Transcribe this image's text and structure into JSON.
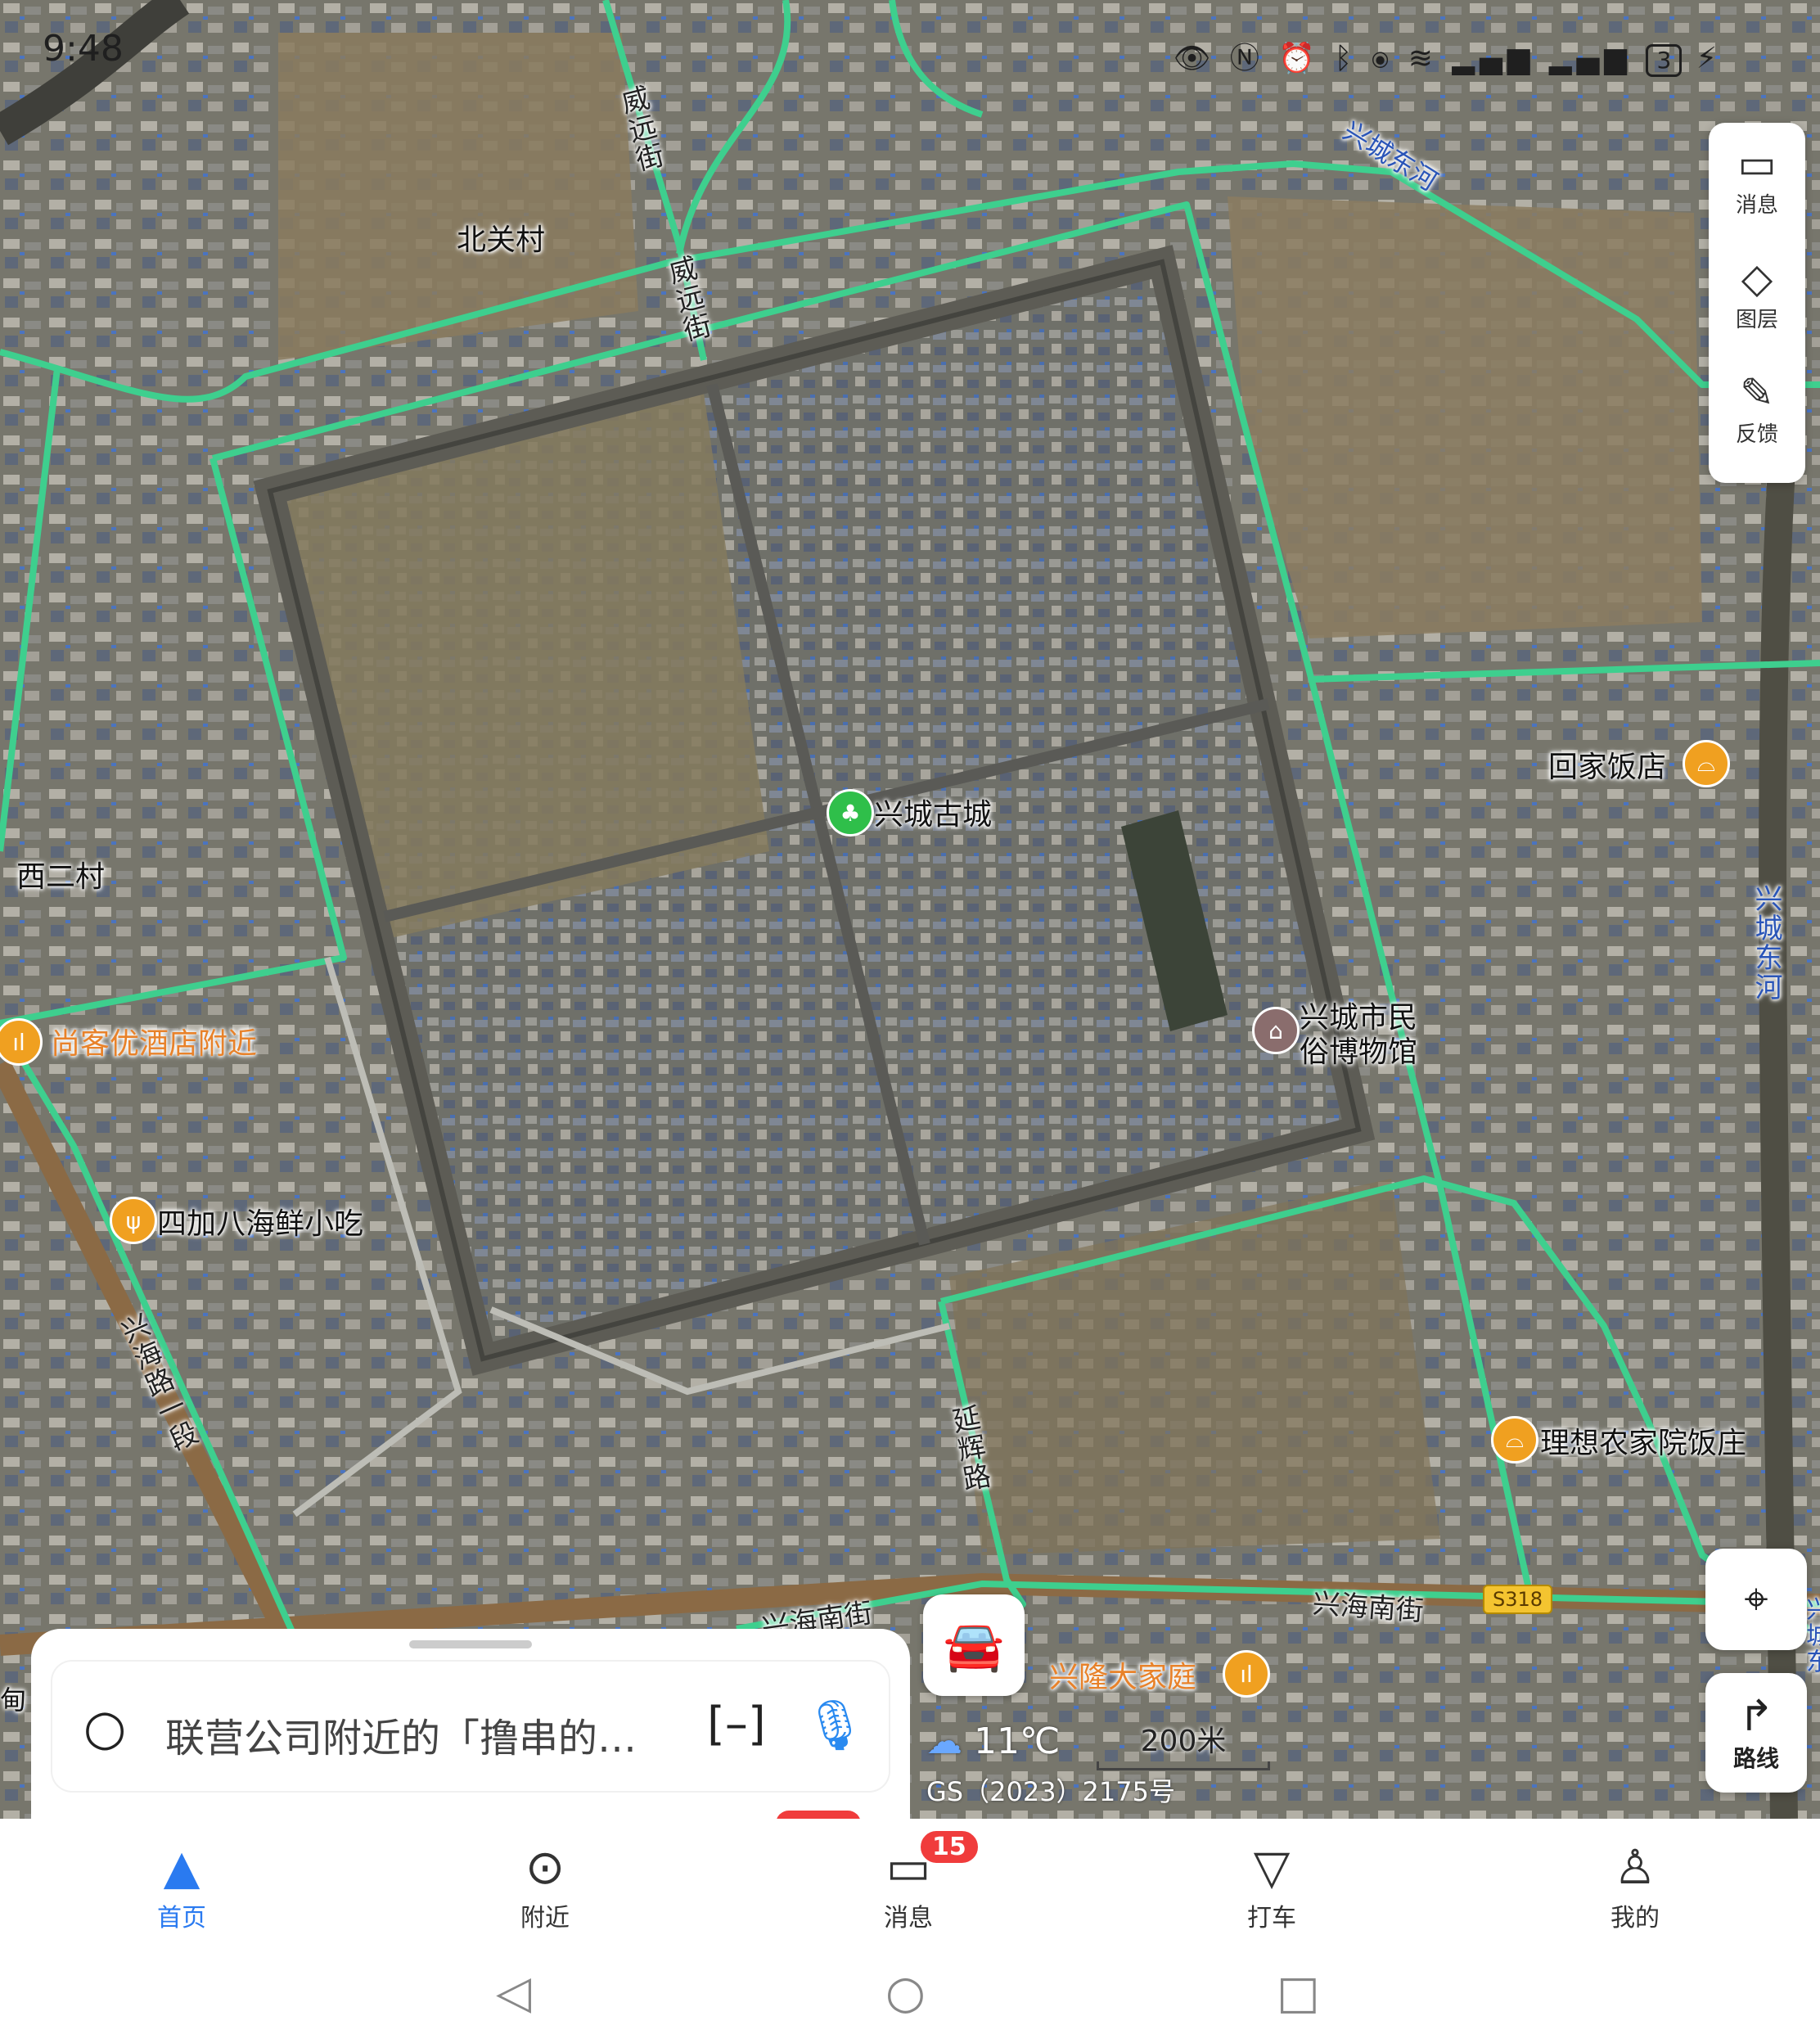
{
  "status_bar": {
    "time": "9:48",
    "icons": [
      "eye-icon",
      "nfc-icon",
      "alarm-icon",
      "bluetooth-icon",
      "location-icon",
      "wifi-icon",
      "signal-icon",
      "signal-icon"
    ],
    "battery": "3"
  },
  "map": {
    "type": "satellite",
    "road_color": "#3ecf8e",
    "labels": {
      "beiguan": "北关村",
      "weiyuan1": "威远街",
      "weiyuan2": "威远街",
      "xicheng_river_top": "兴城东河",
      "xicheng_river_right": "兴城东河",
      "xi_er_cun": "西二村",
      "xinghai_road": "兴海路一段",
      "xinghai_south1": "兴海南街",
      "xinghai_south2": "兴海南街",
      "yanhui": "延辉路",
      "xingcheng_partial": "兴城东"
    },
    "pois": {
      "gucheng": "兴城古城",
      "museum_l1": "兴城市民",
      "museum_l2": "俗博物馆",
      "huijia": "回家饭店",
      "shangke": "尚客优酒店附近",
      "sijiaba": "四加八海鲜小吃",
      "lixiang": "理想农家院饭庄",
      "xinglong": "兴隆大家庭"
    },
    "route_badge": "S318",
    "left_partial": "甸"
  },
  "side_panel": {
    "message_label": "消息",
    "layers_label": "图层",
    "feedback_label": "反馈"
  },
  "locate_icon": "crosshair-icon",
  "route_button_label": "路线",
  "weather": {
    "icon": "cloud-icon",
    "temp": "11℃"
  },
  "scale": {
    "label": "200米"
  },
  "copyright": "GS（2023）2175号",
  "search": {
    "placeholder": "联营公司附近的「撸串的…"
  },
  "bottom_nav": {
    "items": [
      {
        "label": "首页",
        "icon": "navigation-arrow-icon"
      },
      {
        "label": "附近",
        "icon": "location-pin-icon"
      },
      {
        "label": "消息",
        "icon": "message-icon",
        "count": "15"
      },
      {
        "label": "打车",
        "icon": "taxi-icon"
      },
      {
        "label": "我的",
        "icon": "user-icon"
      }
    ]
  }
}
